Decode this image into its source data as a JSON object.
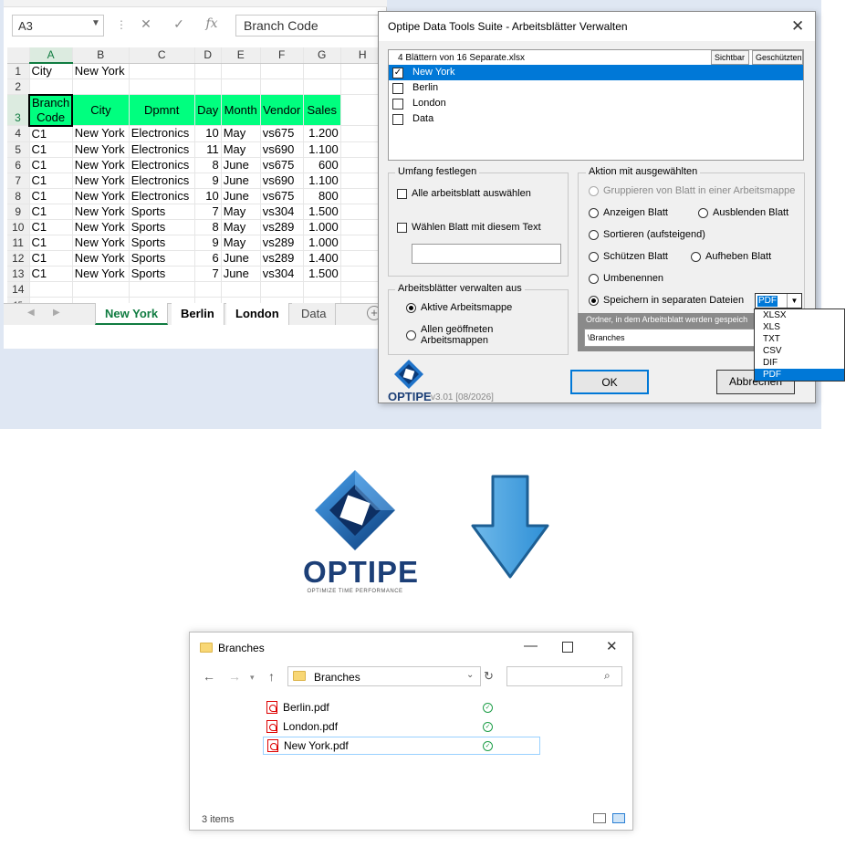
{
  "excel": {
    "name_box": "A3",
    "formula_value": "Branch Code",
    "fx": "fx",
    "columns": [
      "A",
      "B",
      "C",
      "D",
      "E",
      "F",
      "G",
      "H"
    ],
    "rows": [
      {
        "n": "1",
        "cells": [
          "City",
          "New York",
          "",
          "",
          "",
          "",
          ""
        ]
      },
      {
        "n": "2",
        "cells": [
          "",
          "",
          "",
          "",
          "",
          "",
          ""
        ]
      },
      {
        "n": "3",
        "cells": [
          "Branch Code",
          "City",
          "Dpmnt",
          "Day",
          "Month",
          "Vendor",
          "Sales"
        ]
      },
      {
        "n": "4",
        "cells": [
          "C1",
          "New York",
          "Electronics",
          "10",
          "May",
          "vs675",
          "1.200"
        ]
      },
      {
        "n": "5",
        "cells": [
          "C1",
          "New York",
          "Electronics",
          "11",
          "May",
          "vs690",
          "1.100"
        ]
      },
      {
        "n": "6",
        "cells": [
          "C1",
          "New York",
          "Electronics",
          "8",
          "June",
          "vs675",
          "600"
        ]
      },
      {
        "n": "7",
        "cells": [
          "C1",
          "New York",
          "Electronics",
          "9",
          "June",
          "vs690",
          "1.100"
        ]
      },
      {
        "n": "8",
        "cells": [
          "C1",
          "New York",
          "Electronics",
          "10",
          "June",
          "vs675",
          "800"
        ]
      },
      {
        "n": "9",
        "cells": [
          "C1",
          "New York",
          "Sports",
          "7",
          "May",
          "vs304",
          "1.500"
        ]
      },
      {
        "n": "10",
        "cells": [
          "C1",
          "New York",
          "Sports",
          "8",
          "May",
          "vs289",
          "1.000"
        ]
      },
      {
        "n": "11",
        "cells": [
          "C1",
          "New York",
          "Sports",
          "9",
          "May",
          "vs289",
          "1.000"
        ]
      },
      {
        "n": "12",
        "cells": [
          "C1",
          "New York",
          "Sports",
          "6",
          "June",
          "vs289",
          "1.400"
        ]
      },
      {
        "n": "13",
        "cells": [
          "C1",
          "New York",
          "Sports",
          "7",
          "June",
          "vs304",
          "1.500"
        ]
      },
      {
        "n": "14",
        "cells": [
          "",
          "",
          "",
          "",
          "",
          "",
          ""
        ]
      },
      {
        "n": "15",
        "cells": [
          "",
          "",
          "",
          "",
          "",
          "",
          ""
        ]
      }
    ],
    "tabs": [
      "New York",
      "Berlin",
      "London",
      "Data"
    ],
    "header_color": "#00ff7f",
    "accent": "#107c41"
  },
  "dialog": {
    "title": "Optipe Data Tools Suite - Arbeitsblätter Verwalten",
    "list_caption": "4 Blättern von 16 Separate.xlsx",
    "col_visible": "Sichtbar",
    "col_protected": "Geschützten",
    "sheets": [
      {
        "name": "New York",
        "checked": true,
        "selected": true
      },
      {
        "name": "Berlin",
        "checked": false,
        "selected": false
      },
      {
        "name": "London",
        "checked": false,
        "selected": false
      },
      {
        "name": "Data",
        "checked": false,
        "selected": false
      }
    ],
    "scope": {
      "title": "Umfang festlegen",
      "select_all": "Alle arbeitsblatt auswählen",
      "select_text": "Wählen Blatt mit diesem Text"
    },
    "manage_from": {
      "title": "Arbeitsblätter verwalten aus",
      "active": "Aktive Arbeitsmappe",
      "all_open": "Allen geöffneten Arbeitsmappen"
    },
    "actions": {
      "title": "Aktion mit ausgewählten",
      "group": "Gruppieren von Blatt in einer Arbeitsmappe",
      "show": "Anzeigen Blatt",
      "hide": "Ausblenden Blatt",
      "sort": "Sortieren (aufsteigend)",
      "protect": "Schützen Blatt",
      "unprotect": "Aufheben Blatt",
      "rename": "Umbenennen",
      "save_separate": "Speichern in separaten Dateien",
      "format_value": "PDF",
      "formats": [
        "XLSX",
        "XLS",
        "TXT",
        "CSV",
        "DIF",
        "PDF"
      ]
    },
    "folder_label": "Ordner, in dem Arbeitsblatt werden gespeich",
    "folder_value": "\\Branches",
    "ok": "OK",
    "cancel": "Abbrechen",
    "brand": "OPTIPE",
    "version": "v3.01 [08/2026]"
  },
  "logo": {
    "name": "OPTIPE",
    "tagline": "OPTIMIZE TIME PERFORMANCE"
  },
  "explorer": {
    "title": "Branches",
    "address": "Branches",
    "files": [
      "Berlin.pdf",
      "London.pdf",
      "New York.pdf"
    ],
    "status": "3 items"
  }
}
